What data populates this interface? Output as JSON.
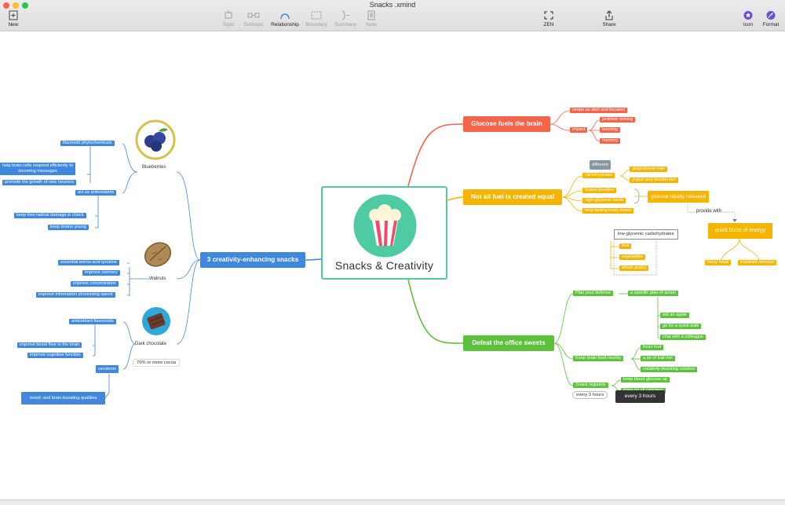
{
  "window": {
    "title": "Snacks .xmind"
  },
  "toolbar": {
    "new": "New",
    "topic": "Topic",
    "subtopic": "Subtopic",
    "relationship": "Relationship",
    "boundary": "Boundary",
    "summary": "Summary",
    "note": "Note",
    "zen": "ZEN",
    "share": "Share",
    "icon": "Icon",
    "format": "Format"
  },
  "colors": {
    "glucose": "#f4644a",
    "fuel": "#f5b400",
    "defeat": "#5cc23c",
    "snacks": "#3f88de",
    "center_border": "#4ecba3"
  },
  "center": {
    "title": "Snacks & Creativity",
    "image": "popcorn-icon"
  },
  "glucose": {
    "label": "Glucose fuels the brain",
    "alert": "keeps us alert and focused",
    "impact": "impact",
    "problem": "problem solving",
    "learning": "learning",
    "memory": "memory"
  },
  "fuel": {
    "label": "Not all fuel is created equal",
    "different": "different",
    "carbs": "carbohydrates",
    "ginger": "gingerbread men",
    "yogurt": "yogurt and blueberries",
    "baked": "Baked goodies",
    "high_gly": "high-glycemic foods",
    "long_lasting": "long-lasting brain power",
    "rapid": "glucose rapidly released",
    "provide": "provide with",
    "burst": "quick burst of energy",
    "fuzzy": "fuzzy head",
    "impaired": "impaired memory",
    "low_gly": "low-glycemic carbohydrates",
    "fruit": "fruit",
    "veg": "vegetables",
    "whole": "whole grains"
  },
  "defeat": {
    "label": "Defeat the office sweets",
    "plan": "Plan your defense",
    "specific": "a specific plan of action",
    "apple": "eat an apple",
    "walk": "go for a quick walk",
    "chat": "chat with a colleague",
    "keep_food": "Keep brain food nearby",
    "fresh": "fresh fruit",
    "trail": "a jar of trail mix",
    "combos": "creativity-boosting combos",
    "snack_reg": "Snack regularly",
    "blood": "keep blood glucose up",
    "cylinders": "firing on all cylinders",
    "every": "every 3 hours",
    "tooltip": "every 3 hours"
  },
  "snacks": {
    "label": "3 creativity-enhancing snacks",
    "blueberries": "Blueberries",
    "flavonoid": "flavonoid phytochemicals",
    "help_cells_1": "help brain cells respond efficiently to",
    "help_cells_2": "incoming messages",
    "promote": "promote the growth of new neurons",
    "antiox": "act as antioxidants",
    "free_radical": "keep free-radical damage in check",
    "young": "keep brains young",
    "walnuts": "Walnuts",
    "amino": "essential amino acid tyrosine",
    "imp_memory": "improve memory",
    "imp_conc": "improve concentration",
    "imp_speed": "improve information processing speed",
    "dark": "Dark chocolate",
    "cocoa": "70% or more cocoa",
    "antiox_flav": "antioxidant flavonoids",
    "blood_flow": "improve blood flow to the brain",
    "cognitive": "improve cognitive function",
    "serotonin": "serotonin",
    "mood": "mood- and brain-boosting qualities"
  }
}
